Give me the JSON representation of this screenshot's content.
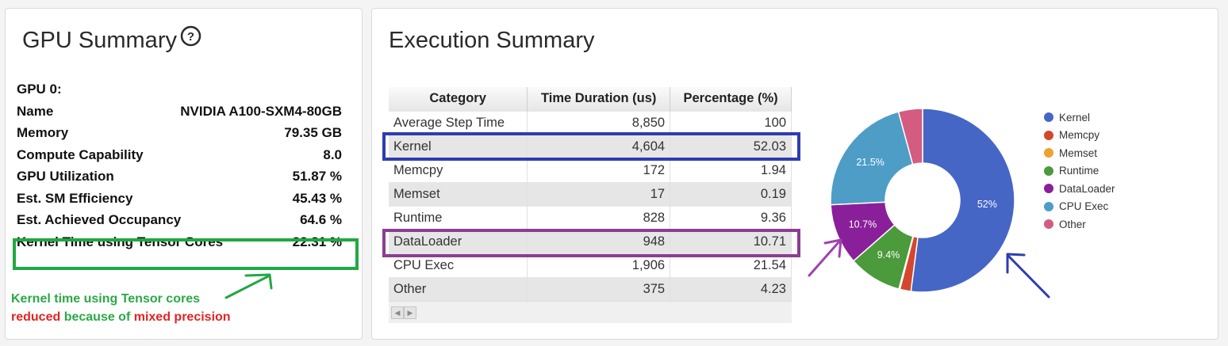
{
  "gpu_summary": {
    "title": "GPU Summary",
    "help_icon": "question-circle-icon",
    "rows": [
      {
        "label": "GPU 0:",
        "value": ""
      },
      {
        "label": "Name",
        "value": "NVIDIA A100-SXM4-80GB"
      },
      {
        "label": "Memory",
        "value": "79.35 GB"
      },
      {
        "label": "Compute Capability",
        "value": "8.0"
      },
      {
        "label": "GPU Utilization",
        "value": "51.87 %"
      },
      {
        "label": "Est. SM Efficiency",
        "value": "45.43 %"
      },
      {
        "label": "Est. Achieved Occupancy",
        "value": "64.6 %"
      },
      {
        "label": "Kernel Time using Tensor Cores",
        "value": "22.31 %"
      }
    ],
    "note_line1": "Kernel time using Tensor cores",
    "note_line2_red1": "reduced",
    "note_line2_green": " because of ",
    "note_line2_red2": "mixed precision"
  },
  "execution_summary": {
    "title": "Execution Summary",
    "columns": [
      "Category",
      "Time Duration (us)",
      "Percentage (%)"
    ],
    "rows": [
      [
        "Average Step Time",
        "8,850",
        "100"
      ],
      [
        "Kernel",
        "4,604",
        "52.03"
      ],
      [
        "Memcpy",
        "172",
        "1.94"
      ],
      [
        "Memset",
        "17",
        "0.19"
      ],
      [
        "Runtime",
        "828",
        "9.36"
      ],
      [
        "DataLoader",
        "948",
        "10.71"
      ],
      [
        "CPU Exec",
        "1,906",
        "21.54"
      ],
      [
        "Other",
        "375",
        "4.23"
      ]
    ]
  },
  "chart_data": {
    "type": "pie",
    "donut": true,
    "categories": [
      "Kernel",
      "Memcpy",
      "Memset",
      "Runtime",
      "DataLoader",
      "CPU Exec",
      "Other"
    ],
    "values": [
      52.03,
      1.94,
      0.19,
      9.36,
      10.71,
      21.54,
      4.23
    ],
    "labels": [
      "52%",
      "",
      "",
      "9.4%",
      "10.7%",
      "21.5%",
      ""
    ],
    "colors": [
      "#4666c6",
      "#d4472e",
      "#f0a030",
      "#4b9a3b",
      "#8a1f9a",
      "#4d9dc7",
      "#d45c80"
    ],
    "legend_position": "right"
  },
  "annotation_colors": {
    "tensor": "#22a843",
    "kernel": "#2f3db0",
    "dataloader": "#8c3d93",
    "note_red": "#e02424"
  }
}
